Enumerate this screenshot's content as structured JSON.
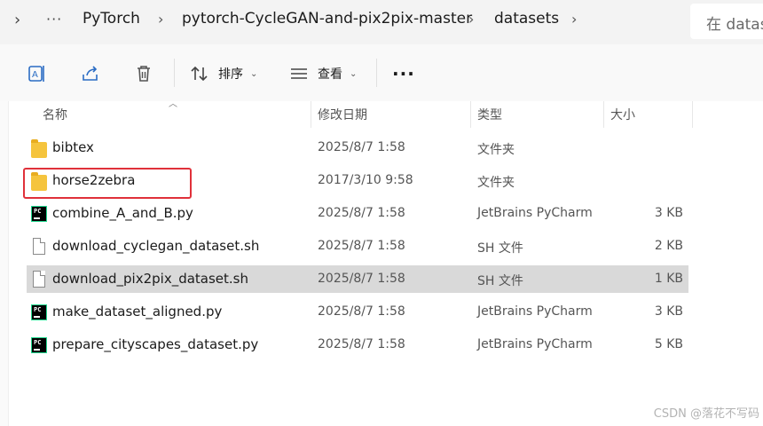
{
  "address_bar": {
    "breadcrumbs": [
      "PyTorch",
      "pytorch-CycleGAN-and-pix2pix-master",
      "datasets"
    ],
    "more_label": "···",
    "search_placeholder": "在 datas"
  },
  "toolbar": {
    "sort_label": "排序",
    "view_label": "查看",
    "more_label": "···"
  },
  "columns": {
    "name": "名称",
    "modified": "修改日期",
    "type": "类型",
    "size": "大小"
  },
  "files": [
    {
      "name": "bibtex",
      "modified": "2025/8/7 1:58",
      "type": "文件夹",
      "size": "",
      "icon": "folder-icon"
    },
    {
      "name": "horse2zebra",
      "modified": "2017/3/10 9:58",
      "type": "文件夹",
      "size": "",
      "icon": "folder-icon"
    },
    {
      "name": "combine_A_and_B.py",
      "modified": "2025/8/7 1:58",
      "type": "JetBrains PyCharm",
      "size": "3 KB",
      "icon": "pycharm-icon"
    },
    {
      "name": "download_cyclegan_dataset.sh",
      "modified": "2025/8/7 1:58",
      "type": "SH 文件",
      "size": "2 KB",
      "icon": "file-icon"
    },
    {
      "name": "download_pix2pix_dataset.sh",
      "modified": "2025/8/7 1:58",
      "type": "SH 文件",
      "size": "1 KB",
      "icon": "file-icon"
    },
    {
      "name": "make_dataset_aligned.py",
      "modified": "2025/8/7 1:58",
      "type": "JetBrains PyCharm",
      "size": "3 KB",
      "icon": "pycharm-icon"
    },
    {
      "name": "prepare_cityscapes_dataset.py",
      "modified": "2025/8/7 1:58",
      "type": "JetBrains PyCharm",
      "size": "5 KB",
      "icon": "pycharm-icon"
    }
  ],
  "selected_index": 4,
  "highlighted_index": 1,
  "pycharm_icon_text": "PC",
  "watermark": "CSDN @落花不写码",
  "colors": {
    "highlight_border": "#e0313a",
    "selected_row": "#d9d9d9",
    "folder": "#f5c43d"
  }
}
